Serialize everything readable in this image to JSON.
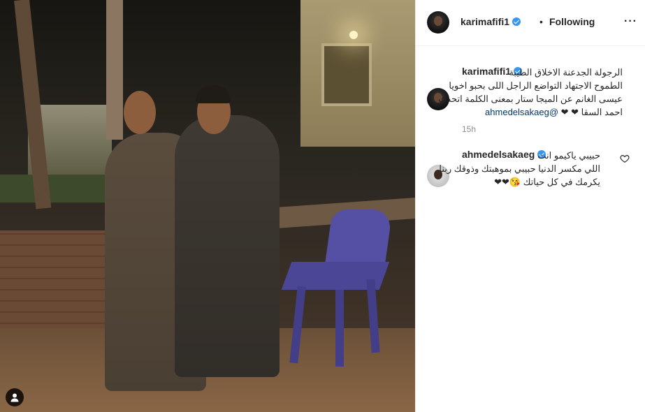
{
  "photo": {
    "icons": {
      "tagged_people": "person-icon"
    }
  },
  "header": {
    "username": "karimafifi1",
    "verified": true,
    "separator": "•",
    "follow_status": "Following",
    "more_icon": "more-icon",
    "more_label": "···"
  },
  "caption": {
    "username": "karimafifi1",
    "verified": true,
    "line1": "الرجولة الجدعنة الاخلاق الطيبة",
    "line2": "الطموح الاجتهاد التواضع الراجل اللى بحبو اخويا",
    "line3": "عيسى الغانم عن الميجا ستار بمعنى الكلمة اتحدث",
    "line4_mention": "@ahmedelsakaeg",
    "line4_text": "احمد السقا ❤ ❤",
    "time": "15h"
  },
  "comment": {
    "username": "ahmedelsakaeg",
    "verified": true,
    "line1": "حبيبي ياكيمو انت",
    "line2": "اللي مكسر الدنيا حبيبي بموهبتك وذوقك ربنا",
    "line3": "يكرمك في كل حياتك 😘❤❤",
    "heart_icon": "heart-icon"
  },
  "colors": {
    "verified_blue": "#3897f0",
    "mention": "#00376b",
    "muted": "#8e8e8e",
    "text": "#262626"
  }
}
